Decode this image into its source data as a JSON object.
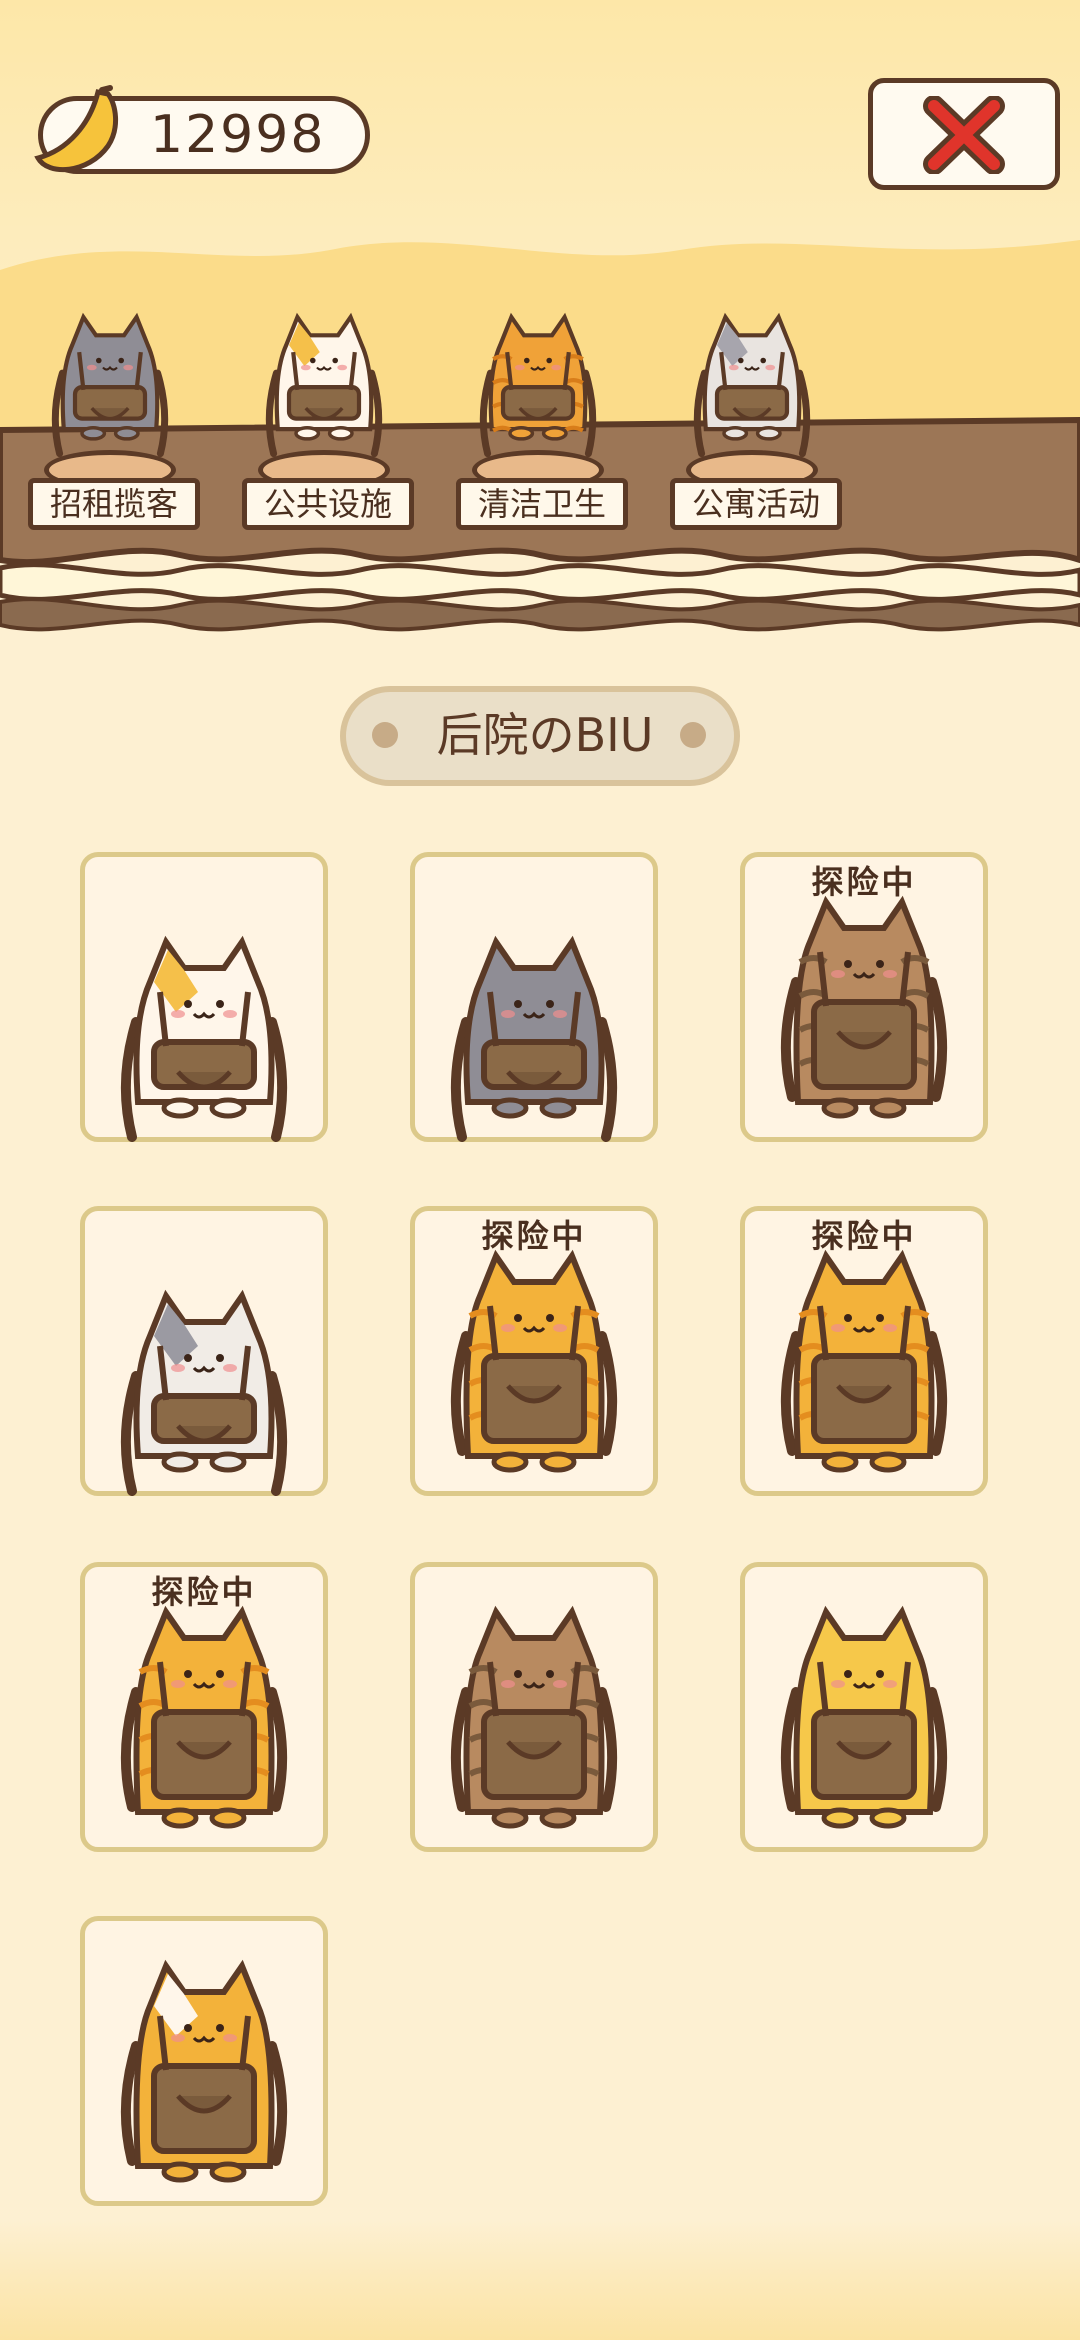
{
  "header": {
    "banana_count": "12998",
    "icons": {
      "currency": "banana-icon",
      "close": "close-x-icon"
    },
    "close_color": "#e0342b"
  },
  "staff": [
    {
      "label": "招租揽客",
      "variant": "gray-hat"
    },
    {
      "label": "公共设施",
      "variant": "calico-chef"
    },
    {
      "label": "清洁卫生",
      "variant": "orange-goggles"
    },
    {
      "label": "公寓活动",
      "variant": "white-jester"
    }
  ],
  "section": {
    "title": "后院のBIU"
  },
  "cats": [
    {
      "status": "",
      "variant": "calico"
    },
    {
      "status": "",
      "variant": "gray"
    },
    {
      "status": "探险中",
      "variant": "tabby-brown"
    },
    {
      "status": "",
      "variant": "gray-white"
    },
    {
      "status": "探险中",
      "variant": "orange-tiger"
    },
    {
      "status": "探险中",
      "variant": "orange-tiger"
    },
    {
      "status": "探险中",
      "variant": "orange-tiger"
    },
    {
      "status": "",
      "variant": "tabby-brown"
    },
    {
      "status": "",
      "variant": "yellow"
    },
    {
      "status": "",
      "variant": "orange-white"
    }
  ],
  "colors": {
    "background": "#fdf0d2",
    "ledge": "#9c7656",
    "outline": "#5b3a26",
    "card_border": "#dcc98a"
  }
}
